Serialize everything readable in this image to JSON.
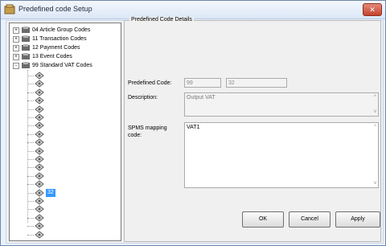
{
  "window": {
    "title": "Predefined code Setup",
    "close_glyph": "✕"
  },
  "tree": {
    "top_items": [
      {
        "label": "04 Article Group Codes",
        "expander": "+"
      },
      {
        "label": "11 Transaction Codes",
        "expander": "+"
      },
      {
        "label": "12 Payment Codes",
        "expander": "+"
      },
      {
        "label": "13 Event Codes",
        "expander": "+"
      },
      {
        "label": "99 Standard VAT Codes",
        "expander": "-"
      }
    ],
    "selected_leaf_label": "32"
  },
  "details": {
    "group_title": "Predefined Code Details",
    "predefined_code_label": "Predefined Code:",
    "predefined_code_values": [
      "99",
      "32"
    ],
    "description_label": "Description:",
    "description_value": "Output VAT",
    "mapping_label_line1": "SPMS mapping",
    "mapping_label_line2": "code:",
    "mapping_value": "VAT1"
  },
  "buttons": {
    "ok": "OK",
    "cancel": "Cancel",
    "apply": "Apply"
  },
  "colors": {
    "selection": "#3399ff",
    "close": "#c5442e"
  }
}
